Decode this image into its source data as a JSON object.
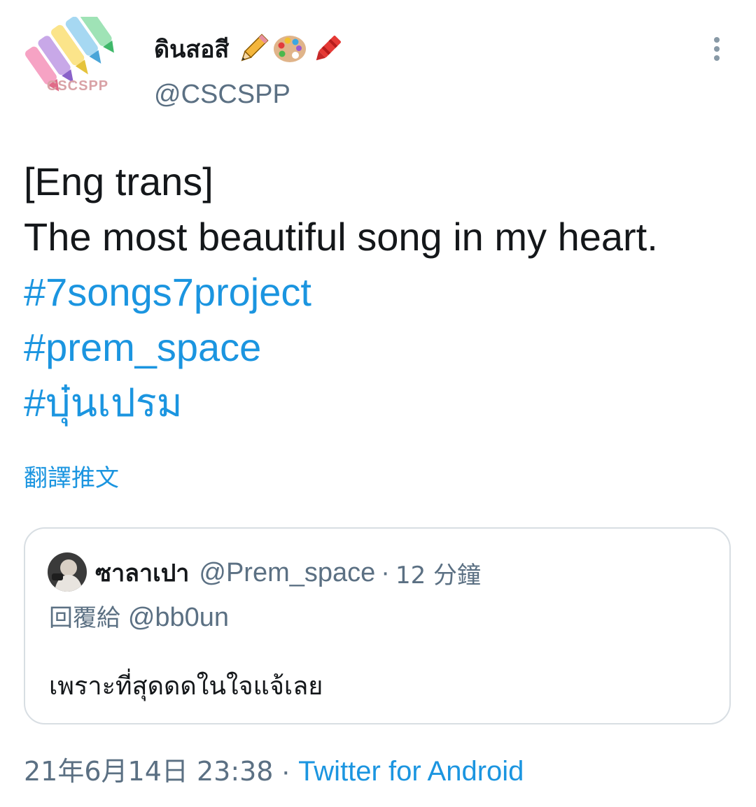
{
  "author": {
    "display_name": "ดินสอสี",
    "name_emojis": [
      "pencil-icon",
      "artist-palette-icon",
      "crayon-icon"
    ],
    "username": "@CSCSPP",
    "avatar_caption": "CSCSPP"
  },
  "tweet": {
    "lines": [
      "[Eng trans]",
      "The most beautiful song in my heart."
    ],
    "hashtags": [
      "#7songs7project",
      "#prem_space",
      "#บุ๋นเปรม"
    ],
    "translate_label": "翻譯推文"
  },
  "quoted_tweet": {
    "display_name": "ซาลาเปา",
    "username": "@Prem_space",
    "separator": "·",
    "time": "12 分鐘",
    "reply_label": "回覆給",
    "reply_handle": "@bb0un",
    "text": "เพราะที่สุดดดในใจแจ้เลย"
  },
  "meta": {
    "timestamp": "21年6月14日 23:38",
    "separator": "·",
    "source": "Twitter for Android"
  },
  "colors": {
    "link": "#1b95e0",
    "secondary_text": "#5b7083",
    "primary_text": "#14171a",
    "border": "#d8dee3"
  }
}
